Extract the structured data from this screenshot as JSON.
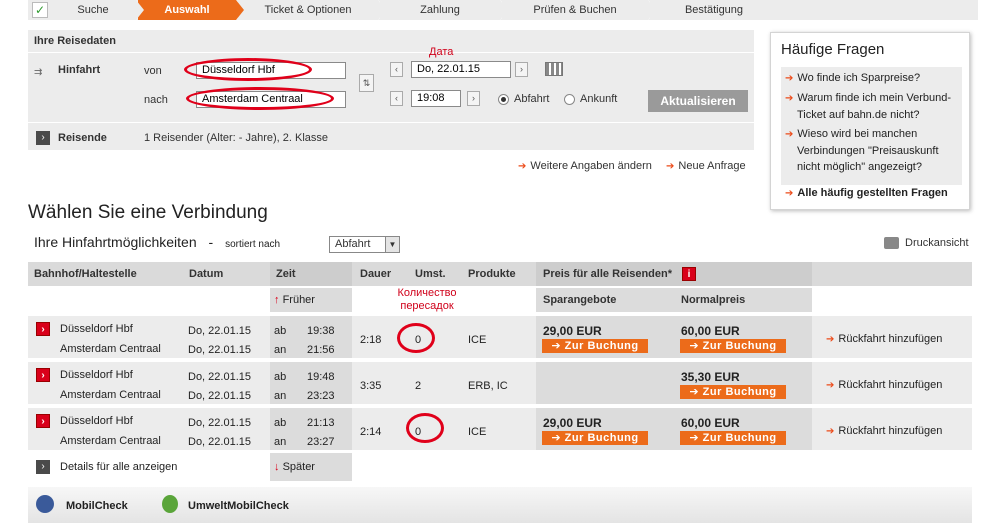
{
  "progress": {
    "steps": [
      "Suche",
      "Auswahl",
      "Ticket & Optionen",
      "Zahlung",
      "Prüfen & Buchen",
      "Bestätigung"
    ],
    "active_color": "#ec6b1a"
  },
  "reisedaten": {
    "title": "Ihre Reisedaten",
    "hinfahrt_label": "Hinfahrt",
    "von_label": "von",
    "von_value": "Düsseldorf Hbf",
    "nach_label": "nach",
    "nach_value": "Amsterdam Centraal",
    "date_value": "Do, 22.01.15",
    "time_value": "19:08",
    "abfahrt_label": "Abfahrt",
    "ankunft_label": "Ankunft",
    "update_button": "Aktualisieren",
    "reisende_label": "Reisende",
    "reisende_value": "1 Reisender (Alter: - Jahre), 2. Klasse",
    "more_link": "Weitere Angaben ändern",
    "new_link": "Neue Anfrage"
  },
  "annotations": {
    "date": "Дата",
    "transfers": "Количество пересадок"
  },
  "faq": {
    "title": "Häufige Fragen",
    "items": [
      "Wo finde ich Sparpreise?",
      "Warum finde ich mein Verbund-Ticket auf bahn.de nicht?",
      "Wieso wird bei manchen Verbindungen \"Preisauskunft nicht möglich\" angezeigt?"
    ],
    "all_link": "Alle häufig gestellten Fragen"
  },
  "main": {
    "heading": "Wählen Sie eine Verbindung",
    "subheading": "Ihre Hinfahrtmöglichkeiten",
    "sort_dash": "-",
    "sort_label": "sortiert nach",
    "sort_value": "Abfahrt",
    "print_label": "Druckansicht"
  },
  "table": {
    "headers": {
      "station": "Bahnhof/Haltestelle",
      "date": "Datum",
      "time": "Zeit",
      "duration": "Dauer",
      "transfers": "Umst.",
      "products": "Produkte",
      "price": "Preis für alle Reisenden*",
      "info_icon": "i",
      "spar": "Sparangebote",
      "normal": "Normalpreis"
    },
    "earlier": "Früher",
    "later": "Später",
    "details_all": "Details für alle anzeigen",
    "dep_prefix": "ab",
    "arr_prefix": "an",
    "book_label": "Zur Buchung",
    "return_label": "Rückfahrt hinzufügen",
    "rows": [
      {
        "from": "Düsseldorf Hbf",
        "to": "Amsterdam Centraal",
        "date_dep": "Do, 22.01.15",
        "date_arr": "Do, 22.01.15",
        "dep": "19:38",
        "arr": "21:56",
        "duration": "2:18",
        "transfers": "0",
        "products": "ICE",
        "spar": "29,00 EUR",
        "normal": "60,00 EUR"
      },
      {
        "from": "Düsseldorf Hbf",
        "to": "Amsterdam Centraal",
        "date_dep": "Do, 22.01.15",
        "date_arr": "Do, 22.01.15",
        "dep": "19:48",
        "arr": "23:23",
        "duration": "3:35",
        "transfers": "2",
        "products": "ERB, IC",
        "spar": "",
        "normal": "35,30 EUR"
      },
      {
        "from": "Düsseldorf Hbf",
        "to": "Amsterdam Centraal",
        "date_dep": "Do, 22.01.15",
        "date_arr": "Do, 22.01.15",
        "dep": "21:13",
        "arr": "23:27",
        "duration": "2:14",
        "transfers": "0",
        "products": "ICE",
        "spar": "29,00 EUR",
        "normal": "60,00 EUR"
      }
    ]
  },
  "bottom": {
    "mobilcheck": "MobilCheck",
    "umwelt": "UmweltMobilCheck"
  }
}
